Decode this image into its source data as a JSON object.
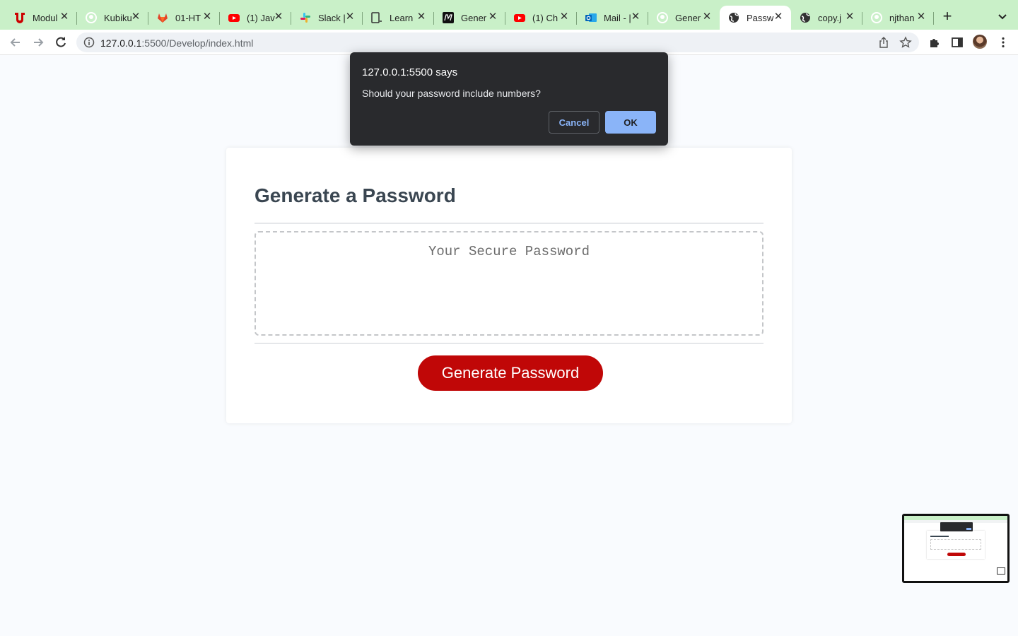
{
  "browser": {
    "tabs": [
      {
        "title": "Modul",
        "icon": "utah-u-icon"
      },
      {
        "title": "Kubiku",
        "icon": "github-icon"
      },
      {
        "title": "01-HT",
        "icon": "gitlab-icon"
      },
      {
        "title": "(1) Jav",
        "icon": "youtube-icon"
      },
      {
        "title": "Slack |",
        "icon": "slack-icon"
      },
      {
        "title": "Learn",
        "icon": "bootcamp-icon"
      },
      {
        "title": "Gener",
        "icon": "medium-icon"
      },
      {
        "title": "(1) Ch",
        "icon": "youtube-icon"
      },
      {
        "title": "Mail - |",
        "icon": "outlook-icon"
      },
      {
        "title": "Gener",
        "icon": "github-icon"
      },
      {
        "title": "Passw",
        "icon": "globe-icon",
        "active": true
      },
      {
        "title": "copy.j",
        "icon": "globe-icon"
      },
      {
        "title": "njthan",
        "icon": "github-icon"
      }
    ],
    "url_host": "127.0.0.1",
    "url_rest": ":5500/Develop/index.html"
  },
  "dialog": {
    "title": "127.0.0.1:5500 says",
    "message": "Should your password include numbers?",
    "cancel_label": "Cancel",
    "ok_label": "OK"
  },
  "page": {
    "heading": "Generate a Password",
    "password_placeholder": "Your Secure Password",
    "generate_label": "Generate Password"
  },
  "colors": {
    "accent": "#c00707",
    "tabstrip": "#c9f0c8",
    "dialog_bg": "#292a2d",
    "dialog_ok": "#8ab4f8"
  }
}
